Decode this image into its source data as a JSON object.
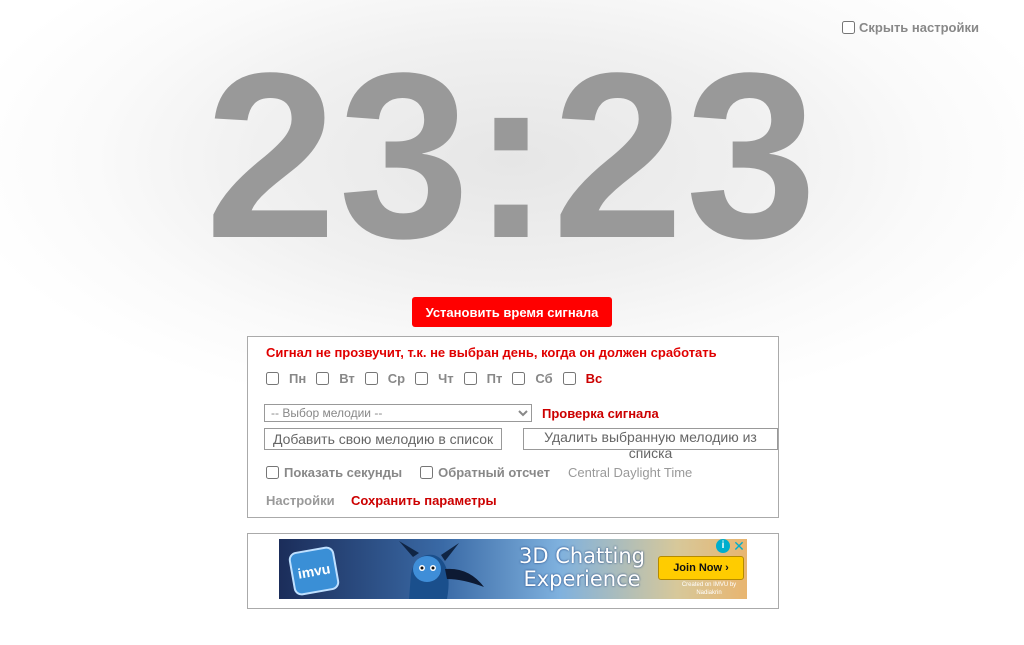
{
  "settings_toggle": {
    "label": "Скрыть настройки",
    "checked": false
  },
  "clock": {
    "time": "23:23"
  },
  "alarm_button": {
    "label": "Установить время сигнала"
  },
  "warning_text": "Сигнал не прозвучит, т.к. не выбран день, когда он должен сработать",
  "days": [
    {
      "label": "Пн",
      "checked": false
    },
    {
      "label": "Вт",
      "checked": false
    },
    {
      "label": "Ср",
      "checked": false
    },
    {
      "label": "Чт",
      "checked": false
    },
    {
      "label": "Пт",
      "checked": false
    },
    {
      "label": "Сб",
      "checked": false
    },
    {
      "label": "Вс",
      "checked": false
    }
  ],
  "melody": {
    "selected": "-- Выбор мелодии --",
    "check_label": "Проверка сигнала",
    "add_label": "Добавить свою мелодию в список",
    "delete_label": "Удалить выбранную мелодию из списка"
  },
  "options": {
    "show_seconds": {
      "label": "Показать секунды",
      "checked": false
    },
    "countdown": {
      "label": "Обратный отсчет",
      "checked": false
    },
    "timezone": "Central Daylight Time"
  },
  "footer": {
    "settings_label": "Настройки",
    "save_label": "Сохранить параметры"
  },
  "ad": {
    "logo": "imvu",
    "headline": "3D Chatting Experience",
    "cta": "Join Now ›",
    "credit": "Created on IMVU by Nadiakrin",
    "info_icon": "i",
    "close_icon": "✕"
  },
  "colors": {
    "accent_red": "#ff0000",
    "clock_gray": "#999999",
    "link_red": "#cc0000"
  }
}
